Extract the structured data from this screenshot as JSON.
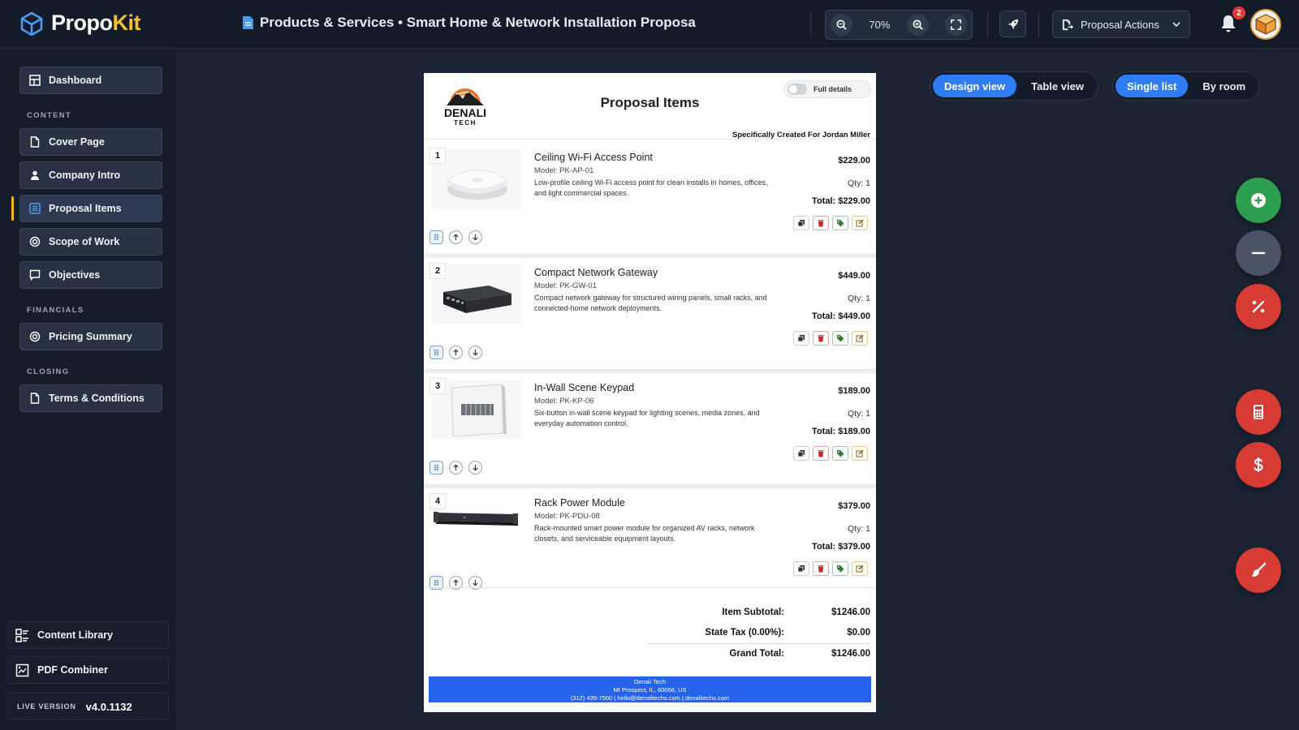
{
  "app": {
    "name_main": "Propo",
    "name_accent": "Kit"
  },
  "header": {
    "doc_title": "Products & Services • Smart Home & Network Installation Proposa",
    "zoom": "70%",
    "actions_label": "Proposal Actions",
    "notifications_count": "2"
  },
  "sidebar": {
    "dashboard": "Dashboard",
    "section_content": "CONTENT",
    "cover_page": "Cover Page",
    "company_intro": "Company Intro",
    "proposal_items": "Proposal Items",
    "scope_of_work": "Scope of Work",
    "objectives": "Objectives",
    "section_financials": "FINANCIALS",
    "pricing_summary": "Pricing Summary",
    "section_closing": "CLOSING",
    "terms": "Terms & Conditions",
    "content_library": "Content Library",
    "pdf_combiner": "PDF Combiner",
    "version_label": "LIVE VERSION",
    "version_value": "v4.0.1132"
  },
  "document": {
    "heading": "Proposal Items",
    "full_details_label": "Full details",
    "created_for": "Specifically Created For Jordan Miller",
    "logo_text": "DENALI",
    "logo_sub": "TECH",
    "items": [
      {
        "num": "1",
        "name": "Ceiling Wi-Fi Access Point",
        "model": "Model: PK-AP-01",
        "desc": "Low-profile ceiling Wi-Fi access point for clean installs in homes, offices, and light commercial spaces.",
        "price": "$229.00",
        "qty": "Qty: 1",
        "total": "Total: $229.00"
      },
      {
        "num": "2",
        "name": "Compact Network Gateway",
        "model": "Model: PK-GW-01",
        "desc": "Compact network gateway for structured wiring panels, small racks, and connected-home network deployments.",
        "price": "$449.00",
        "qty": "Qty: 1",
        "total": "Total: $449.00"
      },
      {
        "num": "3",
        "name": "In-Wall Scene Keypad",
        "model": "Model: PK-KP-06",
        "desc": "Six-button in-wall scene keypad for lighting scenes, media zones, and everyday automation control.",
        "price": "$189.00",
        "qty": "Qty: 1",
        "total": "Total: $189.00"
      },
      {
        "num": "4",
        "name": "Rack Power Module",
        "model": "Model: PK-PDU-08",
        "desc": "Rack-mounted smart power module for organized AV racks, network closets, and serviceable equipment layouts.",
        "price": "$379.00",
        "qty": "Qty: 1",
        "total": "Total: $379.00"
      }
    ],
    "summary": {
      "subtotal_label": "Item Subtotal:",
      "subtotal_value": "$1246.00",
      "tax_label": "State Tax (0.00%):",
      "tax_value": "$0.00",
      "grand_label": "Grand Total:",
      "grand_value": "$1246.00"
    },
    "footer": {
      "company": "Denali Tech",
      "address": "Mt Prospect, IL, 60056, US",
      "contact": "(312) 439-7500 | hello@denalitechs.com | denalitechs.com"
    }
  },
  "views": {
    "design": "Design view",
    "table": "Table view",
    "single": "Single list",
    "room": "By room"
  },
  "colors": {
    "accent_blue": "#2f7cf6",
    "brand_yellow": "#f5c02a",
    "fab_green": "#2e9e4f",
    "fab_gray": "#4a5466",
    "fab_red": "#d63b34",
    "footer_blue": "#2563eb"
  },
  "icons": [
    "dashboard-icon",
    "page-icon",
    "user-icon",
    "list-icon",
    "target-icon",
    "chat-icon",
    "library-icon",
    "pdf-icon",
    "search-minus-icon",
    "search-plus-icon",
    "fullscreen-icon",
    "rocket-icon",
    "bell-icon",
    "plus-icon",
    "minus-icon",
    "percent-icon",
    "calculator-icon",
    "dollar-icon",
    "brush-icon"
  ]
}
